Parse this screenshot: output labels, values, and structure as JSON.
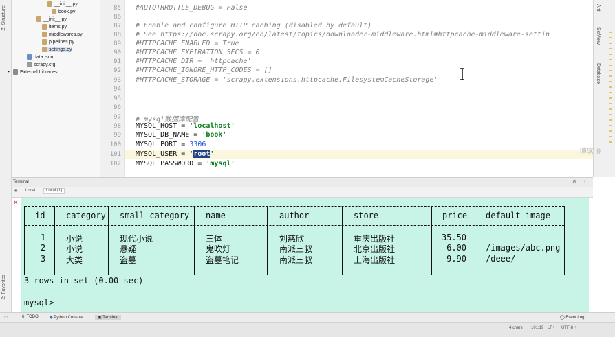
{
  "side_strip": {
    "structure_label": "Z: Structure",
    "favorites_label": "2: Favorites"
  },
  "project_tree": [
    {
      "label": "__init__.py",
      "type": "py"
    },
    {
      "label": "book.py",
      "type": "py"
    },
    {
      "label": "__init__.py",
      "type": "py"
    },
    {
      "label": "items.py",
      "type": "py"
    },
    {
      "label": "middlewares.py",
      "type": "py"
    },
    {
      "label": "pipelines.py",
      "type": "py"
    },
    {
      "label": "settings.py",
      "type": "py"
    },
    {
      "label": "data.json",
      "type": "json"
    },
    {
      "label": "scrapy.cfg",
      "type": "cfg"
    },
    {
      "label": "External Libraries",
      "type": "lib"
    }
  ],
  "editor": {
    "line_numbers": [
      "85",
      "86",
      "87",
      "88",
      "89",
      "90",
      "91",
      "92",
      "93",
      "94",
      "95",
      "96",
      "97",
      "98",
      "99",
      "100",
      "101",
      "102"
    ],
    "lines": {
      "l85": "#AUTOTHROTTLE_DEBUG = False",
      "l87": "# Enable and configure HTTP caching (disabled by default)",
      "l88": "# See https://doc.scrapy.org/en/latest/topics/downloader-middleware.html#httpcache-middleware-settin",
      "l89": "#HTTPCACHE_ENABLED = True",
      "l90": "#HTTPCACHE_EXPIRATION_SECS = 0",
      "l91": "#HTTPCACHE_DIR = 'httpcache'",
      "l92": "#HTTPCACHE_IGNORE_HTTP_CODES = []",
      "l93": "#HTTPCACHE_STORAGE = 'scrapy.extensions.httpcache.FilesystemCacheStorage'",
      "l97": "# mysql数据库配置",
      "l98_key": "MYSQL_HOST = ",
      "l98_val": "'localhost'",
      "l99_key": "MYSQL_DB_NAME = ",
      "l99_val": "'book'",
      "l100_key": "MYSQL_PORT = ",
      "l100_val": "3306",
      "l101_key": "MYSQL_USER = ",
      "l101_val_open": "'",
      "l101_val_sel": "root",
      "l101_val_close": "'",
      "l102_key": "MYSQL_PASSWORD = ",
      "l102_val": "'mysql'"
    }
  },
  "right_strip": {
    "ant_label": "Ant",
    "sciview_label": "SciView",
    "database_label": "Database"
  },
  "terminal": {
    "header_label": "Terminal",
    "tabs": [
      "Local",
      "Local (1)"
    ],
    "table": {
      "columns": [
        "id",
        "category",
        "small_category",
        "name",
        "author",
        "store",
        "price",
        "default_image"
      ],
      "rows": [
        [
          "1",
          "小说",
          "现代小说",
          "三体",
          "刘慈欣",
          "重庆出版社",
          "35.50",
          ""
        ],
        [
          "2",
          "小说",
          "悬疑",
          "鬼吹灯",
          "南派三叔",
          "北京出版社",
          "6.00",
          "/images/abc.png"
        ],
        [
          "3",
          "大类",
          "盗墓",
          "盗墓笔记",
          "南派三叔",
          "上海出版社",
          "9.90",
          "/deee/"
        ]
      ]
    },
    "result_line": "3 rows in set (0.00 sec)",
    "prompt": "mysql>"
  },
  "bottom_toolbar": {
    "todo": "6: TODO",
    "python_console": "Python Console",
    "terminal": "Terminal",
    "event_log": "Event Log"
  },
  "status_bar": {
    "chars": "4 chars",
    "position": "101:19",
    "line_sep": "LF÷",
    "encoding": "UTF-8 ÷"
  },
  "watermark": "博客 9"
}
